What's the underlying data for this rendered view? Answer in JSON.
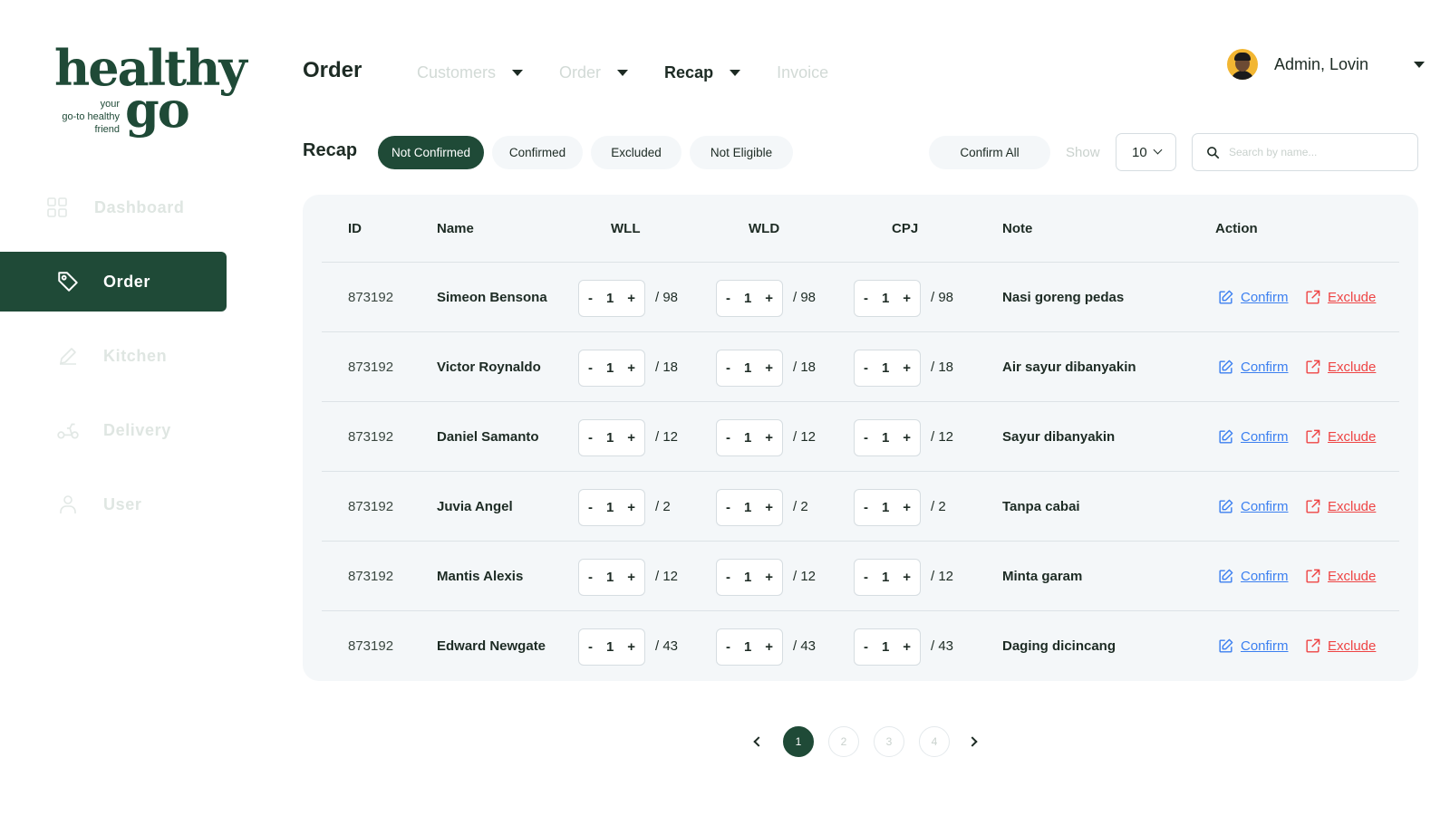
{
  "brand": {
    "word1": "healthy",
    "word2": "go",
    "tagline": [
      "your",
      "go-to healthy",
      "friend"
    ],
    "color": "#1f4a37"
  },
  "sidebar": {
    "items": [
      {
        "label": "Dashboard",
        "icon": "grid-icon",
        "active": false
      },
      {
        "label": "Order",
        "icon": "tag-icon",
        "active": true
      },
      {
        "label": "Kitchen",
        "icon": "pencil-icon",
        "active": false
      },
      {
        "label": "Delivery",
        "icon": "scooter-icon",
        "active": false
      },
      {
        "label": "User",
        "icon": "user-icon",
        "active": false
      }
    ]
  },
  "header": {
    "title": "Order",
    "menu": [
      {
        "label": "Customers",
        "active": false
      },
      {
        "label": "Order",
        "active": false
      },
      {
        "label": "Recap",
        "active": true
      },
      {
        "label": "Invoice",
        "active": false
      }
    ],
    "user_name": "Admin, Lovin"
  },
  "filters": {
    "title": "Recap",
    "chips": [
      "Not Confirmed",
      "Confirmed",
      "Excluded",
      "Not Eligible"
    ],
    "active_chip": "Not Confirmed",
    "confirm_all": "Confirm All",
    "show_label": "Show",
    "show_value": "10",
    "search_placeholder": "Search by name..."
  },
  "table": {
    "columns": [
      "ID",
      "Name",
      "WLL",
      "WLD",
      "CPJ",
      "Note",
      "Action"
    ],
    "confirm_label": "Confirm",
    "exclude_label": "Exclude",
    "stepper_minus": "-",
    "stepper_plus": "+",
    "rows": [
      {
        "id": "873192",
        "name": "Simeon Bensona",
        "wll": "1",
        "wll_max": "/ 98",
        "wld": "1",
        "wld_max": "/ 98",
        "cpj": "1",
        "cpj_max": "/ 98",
        "note": "Nasi goreng pedas"
      },
      {
        "id": "873192",
        "name": "Victor Roynaldo",
        "wll": "1",
        "wll_max": "/ 18",
        "wld": "1",
        "wld_max": "/ 18",
        "cpj": "1",
        "cpj_max": "/ 18",
        "note": "Air sayur dibanyakin"
      },
      {
        "id": "873192",
        "name": "Daniel Samanto",
        "wll": "1",
        "wll_max": "/ 12",
        "wld": "1",
        "wld_max": "/ 12",
        "cpj": "1",
        "cpj_max": "/ 12",
        "note": "Sayur dibanyakin"
      },
      {
        "id": "873192",
        "name": "Juvia Angel",
        "wll": "1",
        "wll_max": "/ 2",
        "wld": "1",
        "wld_max": "/ 2",
        "cpj": "1",
        "cpj_max": "/ 2",
        "note": "Tanpa cabai"
      },
      {
        "id": "873192",
        "name": "Mantis Alexis",
        "wll": "1",
        "wll_max": "/ 12",
        "wld": "1",
        "wld_max": "/ 12",
        "cpj": "1",
        "cpj_max": "/ 12",
        "note": "Minta garam"
      },
      {
        "id": "873192",
        "name": "Edward Newgate",
        "wll": "1",
        "wll_max": "/ 43",
        "wld": "1",
        "wld_max": "/ 43",
        "cpj": "1",
        "cpj_max": "/ 43",
        "note": "Daging dicincang"
      }
    ]
  },
  "pagination": {
    "pages": [
      "1",
      "2",
      "3",
      "4"
    ],
    "current": "1"
  },
  "colors": {
    "primary": "#1f4a37",
    "confirm": "#3b7ff0",
    "exclude": "#ee4444",
    "panel": "#f4f7f9"
  }
}
